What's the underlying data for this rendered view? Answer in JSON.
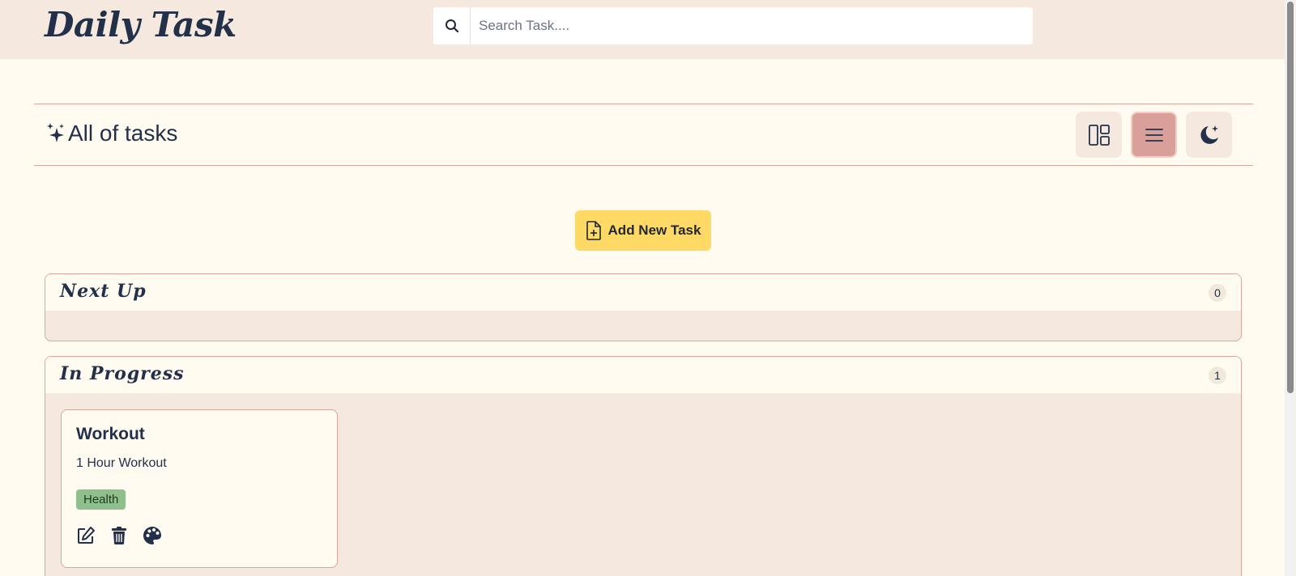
{
  "app": {
    "title": "Daily Task"
  },
  "search": {
    "placeholder": "Search Task...."
  },
  "header": {
    "title": "All of tasks"
  },
  "view_buttons": [
    {
      "icon": "layout-grid-icon"
    },
    {
      "icon": "list-icon",
      "active": true
    },
    {
      "icon": "moon-icon"
    }
  ],
  "add_button": {
    "label": "Add New Task"
  },
  "sections": [
    {
      "title": "Next Up",
      "count": "0"
    },
    {
      "title": "In Progress",
      "count": "1"
    }
  ],
  "tasks": [
    {
      "title": "Workout",
      "description": "1 Hour Workout",
      "tag": "Health",
      "tag_color": "#8fbf8a"
    }
  ],
  "colors": {
    "background": "#fffbf0",
    "topbar": "#f5e9df",
    "accent_button": "#ffd966",
    "active_view": "#d9a099",
    "border": "#d9a89a"
  }
}
